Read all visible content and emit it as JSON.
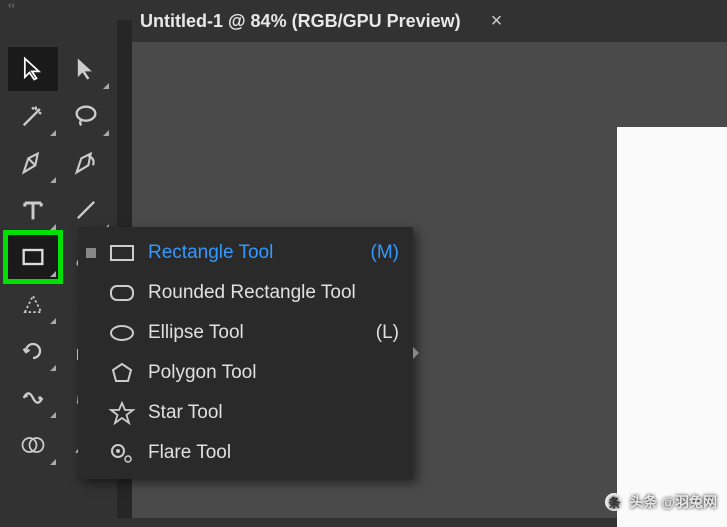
{
  "topbar": {
    "collapse": "‹‹"
  },
  "tab": {
    "title": "Untitled-1 @ 84% (RGB/GPU Preview)",
    "close": "×"
  },
  "flyout": {
    "items": [
      {
        "label": "Rectangle Tool",
        "shortcut": "(M)",
        "active": true,
        "icon": "rect"
      },
      {
        "label": "Rounded Rectangle Tool",
        "shortcut": "",
        "active": false,
        "icon": "roundrect"
      },
      {
        "label": "Ellipse Tool",
        "shortcut": "(L)",
        "active": false,
        "icon": "ellipse"
      },
      {
        "label": "Polygon Tool",
        "shortcut": "",
        "active": false,
        "icon": "polygon"
      },
      {
        "label": "Star Tool",
        "shortcut": "",
        "active": false,
        "icon": "star"
      },
      {
        "label": "Flare Tool",
        "shortcut": "",
        "active": false,
        "icon": "flare"
      }
    ]
  },
  "watermark": {
    "text": "头条 @羽兔网"
  }
}
